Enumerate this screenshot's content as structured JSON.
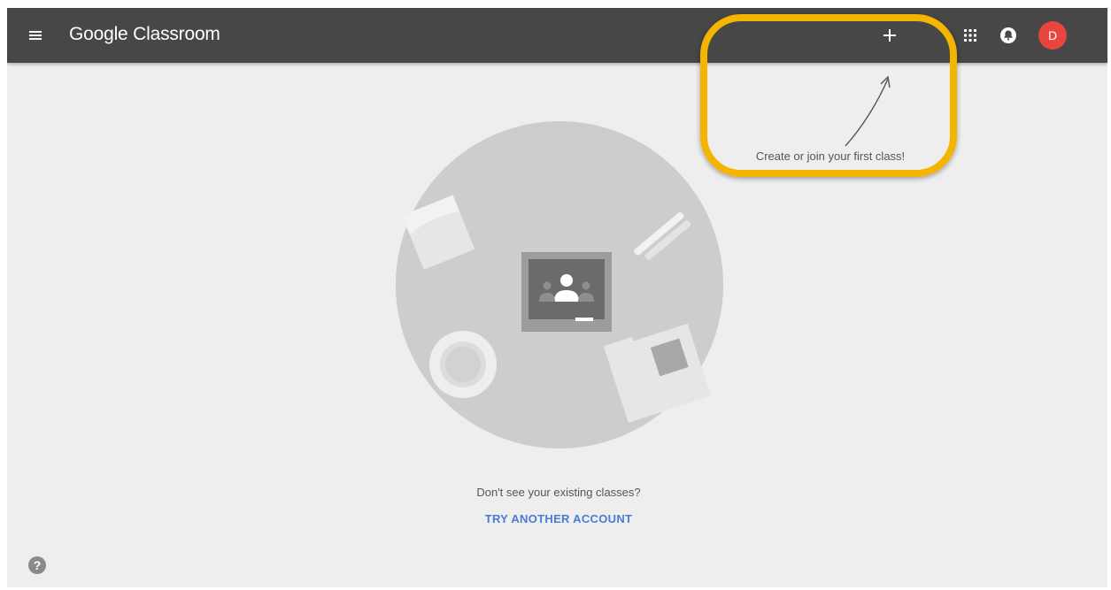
{
  "header": {
    "brand_google": "Google",
    "brand_product": "Classroom",
    "add_label": "+",
    "avatar_initial": "D"
  },
  "hint": {
    "text": "Create or join your first class!"
  },
  "empty_state": {
    "prompt": "Don't see your existing classes?",
    "action": "TRY ANOTHER ACCOUNT"
  },
  "help": {
    "glyph": "?"
  },
  "icons": {
    "menu": "hamburger-menu-icon",
    "add": "plus-icon",
    "apps": "apps-grid-icon",
    "notifications": "bell-icon",
    "help": "help-icon"
  },
  "colors": {
    "topbar": "#474747",
    "background": "#eeeeee",
    "highlight": "#f4b400",
    "avatar": "#e8453c",
    "link": "#4a7bd6"
  }
}
